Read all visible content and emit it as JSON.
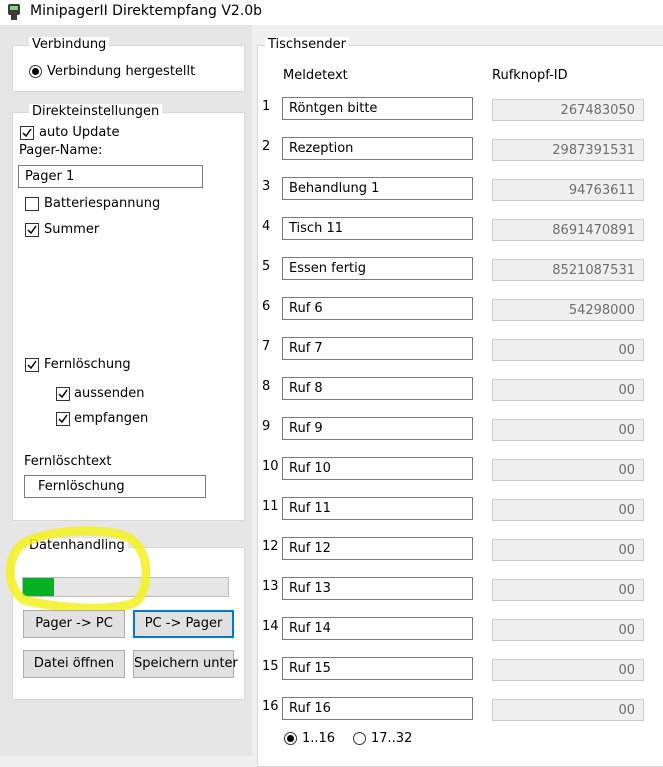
{
  "window": {
    "title": "MinipagerII Direktempfang V2.0b"
  },
  "verbindung": {
    "group_label": "Verbindung",
    "status_label": "Verbindung hergestellt",
    "connected": true
  },
  "direkteinstellungen": {
    "group_label": "Direkteinstellungen",
    "auto_update_label": "auto Update",
    "auto_update": true,
    "pager_name_label": "Pager-Name:",
    "pager_name_value": "Pager 1",
    "batteriespannung_label": "Batteriespannung",
    "batteriespannung": false,
    "summer_label": "Summer",
    "summer": true,
    "fernloeschung_label": "Fernlöschung",
    "fernloeschung": true,
    "aussenden_label": "aussenden",
    "aussenden": true,
    "empfangen_label": "empfangen",
    "empfangen": true,
    "fernloeschtext_label": "Fernlöschtext",
    "fernloeschtext_value": "Fernlöschung"
  },
  "datenhandling": {
    "group_label": "Datenhandling",
    "progress_fraction": 0.15,
    "pager_to_pc_label": "Pager -> PC",
    "pc_to_pager_label": "PC -> Pager",
    "datei_oeffnen_label": "Datei öffnen",
    "speichern_unter_label": "Speichern unter"
  },
  "tischsender": {
    "group_label": "Tischsender",
    "col_meldetext": "Meldetext",
    "col_rufknopf_id": "Rufknopf-ID",
    "rows": [
      {
        "num": "1",
        "text": "Röntgen bitte",
        "id": "267483050"
      },
      {
        "num": "2",
        "text": "Rezeption",
        "id": "2987391531"
      },
      {
        "num": "3",
        "text": "Behandlung 1",
        "id": "94763611"
      },
      {
        "num": "4",
        "text": "Tisch 11",
        "id": "8691470891"
      },
      {
        "num": "5",
        "text": "Essen fertig",
        "id": "8521087531"
      },
      {
        "num": "6",
        "text": "Ruf 6",
        "id": "54298000"
      },
      {
        "num": "7",
        "text": "Ruf 7",
        "id": "00"
      },
      {
        "num": "8",
        "text": "Ruf 8",
        "id": "00"
      },
      {
        "num": "9",
        "text": "Ruf 9",
        "id": "00"
      },
      {
        "num": "10",
        "text": "Ruf 10",
        "id": "00"
      },
      {
        "num": "11",
        "text": "Ruf 11",
        "id": "00"
      },
      {
        "num": "12",
        "text": "Ruf 12",
        "id": "00"
      },
      {
        "num": "13",
        "text": "Ruf 13",
        "id": "00"
      },
      {
        "num": "14",
        "text": "Ruf 14",
        "id": "00"
      },
      {
        "num": "15",
        "text": "Ruf 15",
        "id": "00"
      },
      {
        "num": "16",
        "text": "Ruf 16",
        "id": "00"
      }
    ],
    "range_1_16_label": "1..16",
    "range_17_32_label": "17..32",
    "selected_range": "1..16"
  },
  "colors": {
    "progress_fill": "#06b025",
    "highlight_marker": "#f5f01e",
    "focus_border": "#0078d7"
  }
}
